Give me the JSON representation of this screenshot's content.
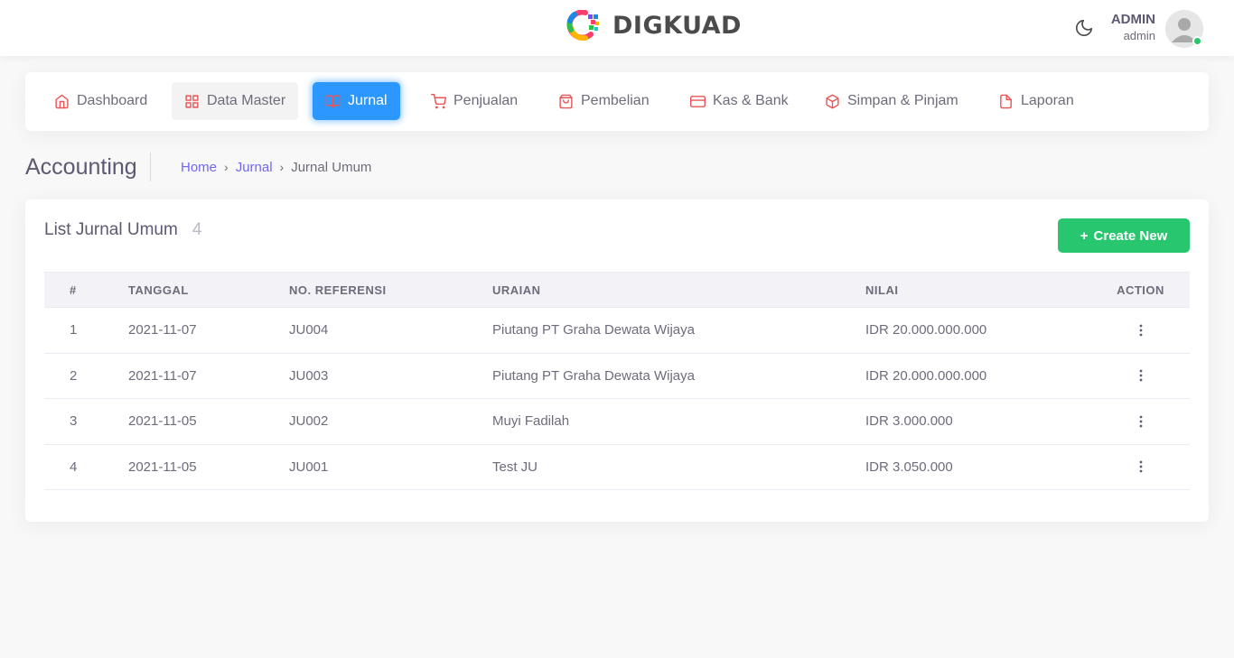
{
  "header": {
    "brand": "DIGKUAD",
    "user_name": "ADMIN",
    "user_role": "admin",
    "icons": {
      "theme": "moon-icon",
      "avatar": "user-avatar-icon"
    },
    "status_color": "#28c76f"
  },
  "menu": {
    "items": [
      {
        "label": "Dashboard",
        "icon": "home-icon"
      },
      {
        "label": "Data Master",
        "icon": "grid-icon"
      },
      {
        "label": "Jurnal",
        "icon": "book-open-icon",
        "active": true
      },
      {
        "label": "Penjualan",
        "icon": "shopping-cart-icon"
      },
      {
        "label": "Pembelian",
        "icon": "shopping-bag-icon"
      },
      {
        "label": "Kas & Bank",
        "icon": "credit-card-icon"
      },
      {
        "label": "Simpan & Pinjam",
        "icon": "box-icon"
      },
      {
        "label": "Laporan",
        "icon": "file-icon"
      }
    ],
    "active_color": "#2c98ff",
    "icon_color": "#ea5455"
  },
  "breadcrumb": {
    "title": "Accounting",
    "items": [
      "Home",
      "Jurnal",
      "Jurnal Umum"
    ],
    "link_color": "#7367f0"
  },
  "card": {
    "title": "List Jurnal Umum",
    "count": "4",
    "create_label": "Create New",
    "create_color": "#28c76f"
  },
  "table": {
    "columns": [
      "#",
      "TANGGAL",
      "NO. REFERENSI",
      "URAIAN",
      "NILAI",
      "ACTION"
    ],
    "rows": [
      {
        "no": "1",
        "tanggal": "2021-11-07",
        "ref": "JU004",
        "uraian": "Piutang PT Graha Dewata Wijaya",
        "nilai": "IDR 20.000.000.000"
      },
      {
        "no": "2",
        "tanggal": "2021-11-07",
        "ref": "JU003",
        "uraian": "Piutang PT Graha Dewata Wijaya",
        "nilai": "IDR 20.000.000.000"
      },
      {
        "no": "3",
        "tanggal": "2021-11-05",
        "ref": "JU002",
        "uraian": "Muyi Fadilah",
        "nilai": "IDR 3.000.000"
      },
      {
        "no": "4",
        "tanggal": "2021-11-05",
        "ref": "JU001",
        "uraian": "Test JU",
        "nilai": "IDR 3.050.000"
      }
    ],
    "action_icon": "more-vertical-icon"
  }
}
